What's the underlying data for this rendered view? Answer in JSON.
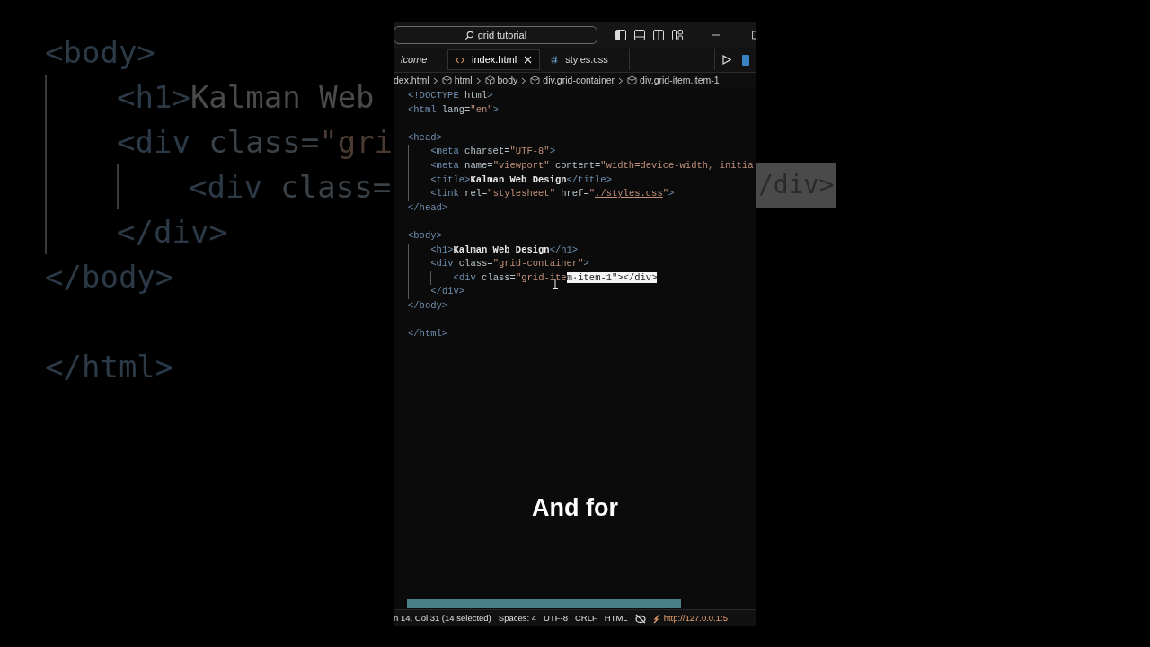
{
  "backdrop": {
    "lines": [
      {
        "tokens": [
          {
            "kind": "tag",
            "t": "<body>"
          }
        ],
        "children": [
          {
            "tokens": [
              {
                "kind": "tag",
                "t": "<h1>"
              },
              {
                "kind": "text",
                "t": "Kalman Web"
              }
            ]
          },
          {
            "tokens": [
              {
                "kind": "tag",
                "t": "<div"
              },
              {
                "kind": "attr",
                "t": " class="
              },
              {
                "kind": "str",
                "t": "\"gri"
              }
            ],
            "children": [
              {
                "tokens": [
                  {
                    "kind": "tag",
                    "t": "<div"
                  },
                  {
                    "kind": "attr",
                    "t": " class="
                  }
                ]
              }
            ]
          },
          {
            "tokens": [
              {
                "kind": "tag",
                "t": "</div>"
              }
            ]
          }
        ]
      },
      {
        "tokens": [
          {
            "kind": "tag",
            "t": "</body>"
          }
        ]
      },
      {
        "gap_before": true,
        "tokens": [
          {
            "kind": "tag",
            "t": "</html>"
          }
        ]
      }
    ],
    "fragment": "/div>"
  },
  "window": {
    "search": "grid tutorial",
    "tabs": [
      {
        "label": "lcome",
        "kind": "plain",
        "selected": false,
        "italic": true
      },
      {
        "label": "index.html",
        "kind": "html",
        "selected": true,
        "italic": false
      },
      {
        "label": "styles.css",
        "kind": "css",
        "selected": false,
        "italic": false
      }
    ],
    "breadcrumbs": [
      {
        "label": "dex.html",
        "icon": false
      },
      {
        "label": "html",
        "icon": true
      },
      {
        "label": "body",
        "icon": true
      },
      {
        "label": "div.grid-container",
        "icon": true
      },
      {
        "label": "div.grid-item.item-1",
        "icon": true
      }
    ],
    "code": [
      {
        "tokens": [
          {
            "kind": "tag",
            "t": "<!DOCTYPE"
          },
          {
            "kind": "attr",
            "t": " html"
          },
          {
            "kind": "tag",
            "t": ">"
          }
        ]
      },
      {
        "tokens": [
          {
            "kind": "tag",
            "t": "<html"
          },
          {
            "kind": "attr",
            "t": " lang="
          },
          {
            "kind": "str",
            "t": "\"en\""
          },
          {
            "kind": "tag",
            "t": ">"
          }
        ]
      },
      {
        "gap_before": true,
        "tokens": [
          {
            "kind": "tag",
            "t": "<head>"
          }
        ],
        "children": [
          {
            "tokens": [
              {
                "kind": "tag",
                "t": "<meta"
              },
              {
                "kind": "attr",
                "t": " charset="
              },
              {
                "kind": "str",
                "t": "\"UTF-8\""
              },
              {
                "kind": "tag",
                "t": ">"
              }
            ]
          },
          {
            "tokens": [
              {
                "kind": "tag",
                "t": "<meta"
              },
              {
                "kind": "attr",
                "t": " name="
              },
              {
                "kind": "str",
                "t": "\"viewport\""
              },
              {
                "kind": "attr",
                "t": " content="
              },
              {
                "kind": "str",
                "t": "\"width=device-width, initia"
              }
            ]
          },
          {
            "tokens": [
              {
                "kind": "tag",
                "t": "<title>"
              },
              {
                "kind": "text",
                "t": "Kalman Web Design"
              },
              {
                "kind": "tag",
                "t": "</title>"
              }
            ]
          },
          {
            "tokens": [
              {
                "kind": "tag",
                "t": "<link"
              },
              {
                "kind": "attr",
                "t": " rel="
              },
              {
                "kind": "str",
                "t": "\"stylesheet\""
              },
              {
                "kind": "attr",
                "t": " href="
              },
              {
                "kind": "str",
                "t": "\""
              },
              {
                "kind": "link",
                "t": "./styles.css"
              },
              {
                "kind": "str",
                "t": "\""
              },
              {
                "kind": "tag",
                "t": ">"
              }
            ]
          }
        ]
      },
      {
        "tokens": [
          {
            "kind": "tag",
            "t": "</head>"
          }
        ]
      },
      {
        "gap_before": true,
        "tokens": [
          {
            "kind": "tag",
            "t": "<body>"
          }
        ],
        "children": [
          {
            "tokens": [
              {
                "kind": "tag",
                "t": "<h1>"
              },
              {
                "kind": "text",
                "t": "Kalman Web Design"
              },
              {
                "kind": "tag",
                "t": "</h1>"
              }
            ]
          },
          {
            "tokens": [
              {
                "kind": "tag",
                "t": "<div"
              },
              {
                "kind": "attr",
                "t": " class="
              },
              {
                "kind": "str",
                "t": "\"grid-container\""
              },
              {
                "kind": "tag",
                "t": ">"
              }
            ],
            "children": [
              {
                "tokens": [
                  {
                    "kind": "tag",
                    "t": "<div"
                  },
                  {
                    "kind": "attr",
                    "t": " class="
                  },
                  {
                    "kind": "str",
                    "t": "\"grid-ite"
                  },
                  {
                    "kind": "sel",
                    "t": "m·item-1\"></div>"
                  }
                ]
              }
            ]
          },
          {
            "tokens": [
              {
                "kind": "tag",
                "t": "</div>"
              }
            ]
          }
        ]
      },
      {
        "tokens": [
          {
            "kind": "tag",
            "t": "</body>"
          }
        ]
      },
      {
        "gap_before": true,
        "tokens": [
          {
            "kind": "tag",
            "t": "</html>"
          }
        ]
      }
    ],
    "status": [
      "n 14, Col 31 (14 selected)",
      "Spaces: 4",
      "UTF-8",
      "CRLF",
      "HTML"
    ],
    "live_server": "http://127.0.0.1:5"
  },
  "caption": "And for"
}
